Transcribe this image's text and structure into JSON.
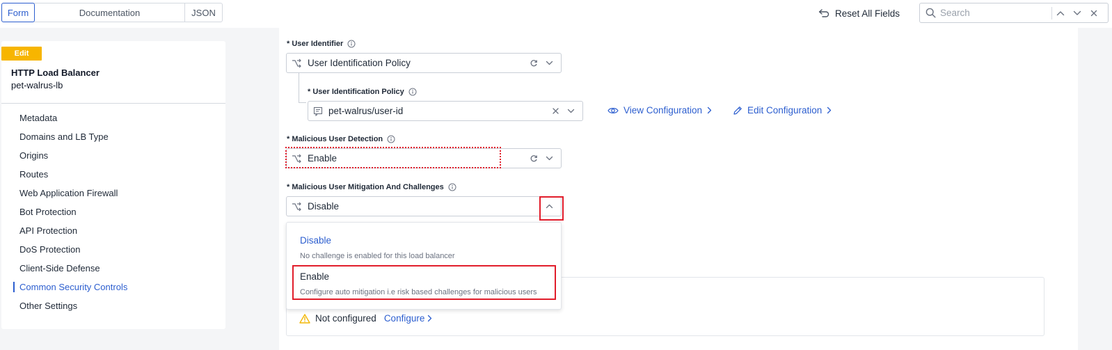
{
  "topbar": {
    "tabs": [
      "Form",
      "Documentation",
      "JSON"
    ],
    "reset_label": "Reset All Fields",
    "search_placeholder": "Search"
  },
  "sidebar": {
    "badge": "Edit",
    "object_type": "HTTP Load Balancer",
    "object_name": "pet-walrus-lb",
    "items": [
      {
        "label": "Metadata"
      },
      {
        "label": "Domains and LB Type"
      },
      {
        "label": "Origins"
      },
      {
        "label": "Routes"
      },
      {
        "label": "Web Application Firewall"
      },
      {
        "label": "Bot Protection"
      },
      {
        "label": "API Protection"
      },
      {
        "label": "DoS Protection"
      },
      {
        "label": "Client-Side Defense"
      },
      {
        "label": "Common Security Controls",
        "active": true
      },
      {
        "label": "Other Settings"
      }
    ]
  },
  "form": {
    "user_identifier": {
      "label": "* User Identifier",
      "value": "User Identification Policy"
    },
    "user_identification_policy": {
      "label": "* User Identification Policy",
      "value": "pet-walrus/user-id",
      "view_link": "View Configuration",
      "edit_link": "Edit Configuration"
    },
    "malicious_user_detection": {
      "label": "* Malicious User Detection",
      "value": "Enable"
    },
    "mitigation": {
      "label": "* Malicious User Mitigation And Challenges",
      "value": "Disable",
      "options": [
        {
          "title": "Disable",
          "description": "No challenge is enabled for this load balancer"
        },
        {
          "title": "Enable",
          "description": "Configure auto mitigation i.e risk based challenges for malicious users"
        }
      ]
    },
    "not_configured": {
      "text": "Not configured",
      "action": "Configure"
    }
  },
  "colors": {
    "accent": "#2c5ecf",
    "edit_badge": "#f7b500",
    "highlight_red": "#e11d2b",
    "warning": "#f2b705"
  }
}
